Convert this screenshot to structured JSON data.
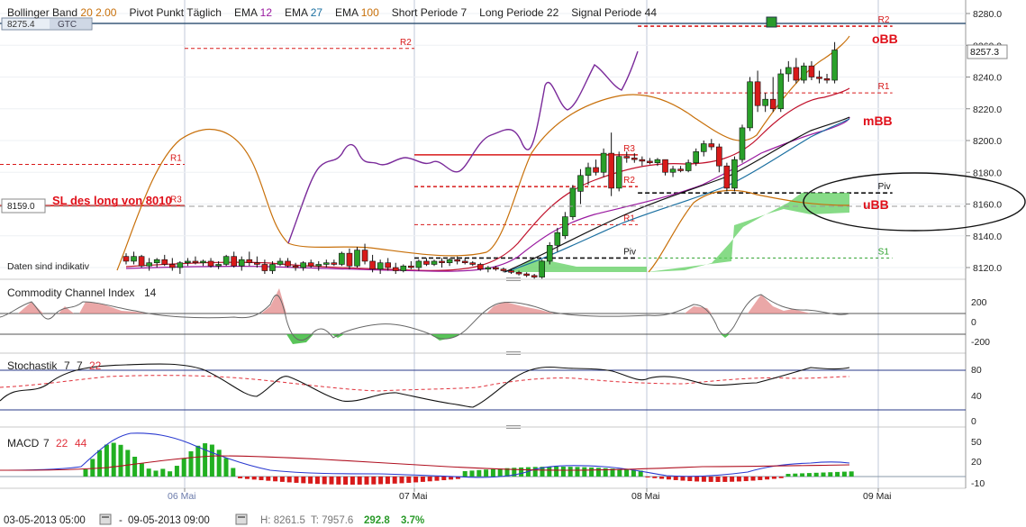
{
  "header": {
    "indicators": [
      {
        "name": "Bollinger Band",
        "params": [
          "20",
          "2.00"
        ],
        "color": "#c8700a"
      },
      {
        "name": "Pivot Punkt",
        "params": [
          "Täglich"
        ],
        "color": "#222222"
      },
      {
        "name": "EMA",
        "params": [
          "12"
        ],
        "color": "#9a1aa0"
      },
      {
        "name": "EMA",
        "params": [
          "27"
        ],
        "color": "#1a6fa0"
      },
      {
        "name": "EMA",
        "params": [
          "100"
        ],
        "color": "#c8700a"
      },
      {
        "name": "Short Periode",
        "params": [
          "7"
        ],
        "color": "#222222"
      },
      {
        "name": "Long Periode",
        "params": [
          "22"
        ],
        "color": "#222222"
      },
      {
        "name": "Signal Periode",
        "params": [
          "44"
        ],
        "color": "#222222"
      }
    ],
    "order_price": "8275.4",
    "order_type": "GTC"
  },
  "price_axis": {
    "ticks": [
      "8280.0",
      "8260.0",
      "8240.0",
      "8220.0",
      "8200.0",
      "8180.0",
      "8160.0",
      "8140.0",
      "8120.0"
    ],
    "current_price": "8257.3",
    "sl_price": "8159.0"
  },
  "annotations": {
    "sl_text": "SL des long von 8010",
    "obb": "oBB",
    "mbb": "mBB",
    "ubb": "uBB",
    "indicative": "Daten sind indikativ"
  },
  "pivots": {
    "r1": "R1",
    "r2": "R2",
    "r3": "R3",
    "piv": "Piv",
    "s1": "S1"
  },
  "cci": {
    "title": "Commodity Channel Index",
    "period": "14",
    "ticks": [
      "200",
      "0",
      "-200"
    ]
  },
  "stoch": {
    "title": "Stochastik",
    "k": "7",
    "d": "7",
    "slow": "22",
    "ticks": [
      "80",
      "40",
      "0"
    ]
  },
  "macd": {
    "title": "MACD",
    "fast": "7",
    "slow": "22",
    "signal": "44",
    "ticks": [
      "50",
      "20",
      "-10"
    ]
  },
  "time_axis": {
    "labels": [
      "06 Mai",
      "07 Mai",
      "08 Mai",
      "09 Mai"
    ]
  },
  "footer": {
    "start": "03-05-2013 05:00",
    "end": "09-05-2013 09:00",
    "high": "H: 8261.5",
    "low": "T: 7957.6",
    "change": "292.8",
    "pct": "3.7%"
  },
  "chart_data": {
    "type": "candlestick",
    "ylim": [
      8112,
      8288
    ],
    "candles": [
      {
        "o": 8127,
        "h": 8129,
        "l": 8122,
        "c": 8124
      },
      {
        "o": 8124,
        "h": 8130,
        "l": 8122,
        "c": 8127
      },
      {
        "o": 8127,
        "h": 8128,
        "l": 8120,
        "c": 8121
      },
      {
        "o": 8121,
        "h": 8126,
        "l": 8118,
        "c": 8123
      },
      {
        "o": 8123,
        "h": 8126,
        "l": 8120,
        "c": 8125
      },
      {
        "o": 8125,
        "h": 8128,
        "l": 8121,
        "c": 8122
      },
      {
        "o": 8122,
        "h": 8126,
        "l": 8118,
        "c": 8120
      },
      {
        "o": 8120,
        "h": 8124,
        "l": 8116,
        "c": 8123
      },
      {
        "o": 8123,
        "h": 8126,
        "l": 8121,
        "c": 8124
      },
      {
        "o": 8124,
        "h": 8127,
        "l": 8122,
        "c": 8123
      },
      {
        "o": 8123,
        "h": 8125,
        "l": 8121,
        "c": 8124
      },
      {
        "o": 8124,
        "h": 8126,
        "l": 8120,
        "c": 8121
      },
      {
        "o": 8121,
        "h": 8124,
        "l": 8119,
        "c": 8122
      },
      {
        "o": 8122,
        "h": 8128,
        "l": 8121,
        "c": 8127
      },
      {
        "o": 8127,
        "h": 8130,
        "l": 8120,
        "c": 8121
      },
      {
        "o": 8121,
        "h": 8127,
        "l": 8118,
        "c": 8125
      },
      {
        "o": 8125,
        "h": 8130,
        "l": 8121,
        "c": 8123
      },
      {
        "o": 8123,
        "h": 8127,
        "l": 8120,
        "c": 8122
      },
      {
        "o": 8122,
        "h": 8125,
        "l": 8116,
        "c": 8118
      },
      {
        "o": 8118,
        "h": 8124,
        "l": 8116,
        "c": 8122
      },
      {
        "o": 8122,
        "h": 8126,
        "l": 8121,
        "c": 8124
      },
      {
        "o": 8124,
        "h": 8126,
        "l": 8120,
        "c": 8121
      },
      {
        "o": 8121,
        "h": 8123,
        "l": 8118,
        "c": 8120
      },
      {
        "o": 8120,
        "h": 8124,
        "l": 8118,
        "c": 8123
      },
      {
        "o": 8123,
        "h": 8125,
        "l": 8120,
        "c": 8121
      },
      {
        "o": 8121,
        "h": 8124,
        "l": 8118,
        "c": 8122
      },
      {
        "o": 8122,
        "h": 8125,
        "l": 8120,
        "c": 8123
      },
      {
        "o": 8123,
        "h": 8125,
        "l": 8121,
        "c": 8122
      },
      {
        "o": 8122,
        "h": 8130,
        "l": 8121,
        "c": 8129
      },
      {
        "o": 8129,
        "h": 8132,
        "l": 8119,
        "c": 8121
      },
      {
        "o": 8121,
        "h": 8133,
        "l": 8120,
        "c": 8131
      },
      {
        "o": 8131,
        "h": 8135,
        "l": 8122,
        "c": 8124
      },
      {
        "o": 8124,
        "h": 8128,
        "l": 8117,
        "c": 8119
      },
      {
        "o": 8119,
        "h": 8125,
        "l": 8116,
        "c": 8123
      },
      {
        "o": 8123,
        "h": 8126,
        "l": 8118,
        "c": 8120
      },
      {
        "o": 8120,
        "h": 8123,
        "l": 8116,
        "c": 8118
      },
      {
        "o": 8118,
        "h": 8122,
        "l": 8117,
        "c": 8121
      },
      {
        "o": 8121,
        "h": 8124,
        "l": 8119,
        "c": 8120
      },
      {
        "o": 8120,
        "h": 8125,
        "l": 8118,
        "c": 8124
      },
      {
        "o": 8124,
        "h": 8126,
        "l": 8121,
        "c": 8122
      },
      {
        "o": 8122,
        "h": 8125,
        "l": 8121,
        "c": 8124
      },
      {
        "o": 8124,
        "h": 8126,
        "l": 8120,
        "c": 8123
      },
      {
        "o": 8123,
        "h": 8126,
        "l": 8121,
        "c": 8125
      },
      {
        "o": 8125,
        "h": 8127,
        "l": 8122,
        "c": 8124
      },
      {
        "o": 8124,
        "h": 8126,
        "l": 8122,
        "c": 8123
      },
      {
        "o": 8123,
        "h": 8124,
        "l": 8121,
        "c": 8122
      },
      {
        "o": 8122,
        "h": 8123,
        "l": 8118,
        "c": 8119
      },
      {
        "o": 8119,
        "h": 8121,
        "l": 8117,
        "c": 8120
      },
      {
        "o": 8120,
        "h": 8121,
        "l": 8118,
        "c": 8119
      },
      {
        "o": 8119,
        "h": 8120,
        "l": 8117,
        "c": 8118
      },
      {
        "o": 8118,
        "h": 8119,
        "l": 8116,
        "c": 8117
      },
      {
        "o": 8117,
        "h": 8118,
        "l": 8115,
        "c": 8116
      },
      {
        "o": 8116,
        "h": 8117,
        "l": 8114,
        "c": 8115
      },
      {
        "o": 8115,
        "h": 8116,
        "l": 8113,
        "c": 8114
      },
      {
        "o": 8114,
        "h": 8125,
        "l": 8113,
        "c": 8124
      },
      {
        "o": 8124,
        "h": 8136,
        "l": 8122,
        "c": 8134
      },
      {
        "o": 8134,
        "h": 8145,
        "l": 8130,
        "c": 8142
      },
      {
        "o": 8140,
        "h": 8155,
        "l": 8138,
        "c": 8152
      },
      {
        "o": 8152,
        "h": 8172,
        "l": 8150,
        "c": 8170
      },
      {
        "o": 8168,
        "h": 8182,
        "l": 8160,
        "c": 8178
      },
      {
        "o": 8178,
        "h": 8186,
        "l": 8172,
        "c": 8183
      },
      {
        "o": 8183,
        "h": 8188,
        "l": 8178,
        "c": 8180
      },
      {
        "o": 8180,
        "h": 8195,
        "l": 8177,
        "c": 8192
      },
      {
        "o": 8192,
        "h": 8205,
        "l": 8165,
        "c": 8170
      },
      {
        "o": 8170,
        "h": 8193,
        "l": 8168,
        "c": 8190
      },
      {
        "o": 8190,
        "h": 8193,
        "l": 8186,
        "c": 8189
      },
      {
        "o": 8189,
        "h": 8192,
        "l": 8186,
        "c": 8188
      },
      {
        "o": 8188,
        "h": 8190,
        "l": 8184,
        "c": 8187
      },
      {
        "o": 8187,
        "h": 8189,
        "l": 8185,
        "c": 8186
      },
      {
        "o": 8186,
        "h": 8189,
        "l": 8184,
        "c": 8188
      },
      {
        "o": 8188,
        "h": 8188,
        "l": 8178,
        "c": 8180
      },
      {
        "o": 8180,
        "h": 8184,
        "l": 8177,
        "c": 8182
      },
      {
        "o": 8182,
        "h": 8184,
        "l": 8180,
        "c": 8181
      },
      {
        "o": 8181,
        "h": 8188,
        "l": 8180,
        "c": 8186
      },
      {
        "o": 8186,
        "h": 8195,
        "l": 8184,
        "c": 8193
      },
      {
        "o": 8193,
        "h": 8200,
        "l": 8190,
        "c": 8198
      },
      {
        "o": 8198,
        "h": 8201,
        "l": 8194,
        "c": 8196
      },
      {
        "o": 8196,
        "h": 8198,
        "l": 8180,
        "c": 8184
      },
      {
        "o": 8184,
        "h": 8186,
        "l": 8168,
        "c": 8170
      },
      {
        "o": 8170,
        "h": 8190,
        "l": 8168,
        "c": 8188
      },
      {
        "o": 8188,
        "h": 8210,
        "l": 8186,
        "c": 8208
      },
      {
        "o": 8208,
        "h": 8240,
        "l": 8206,
        "c": 8237
      },
      {
        "o": 8237,
        "h": 8244,
        "l": 8218,
        "c": 8222
      },
      {
        "o": 8222,
        "h": 8230,
        "l": 8218,
        "c": 8226
      },
      {
        "o": 8226,
        "h": 8240,
        "l": 8218,
        "c": 8220
      },
      {
        "o": 8220,
        "h": 8245,
        "l": 8218,
        "c": 8242
      },
      {
        "o": 8242,
        "h": 8250,
        "l": 8237,
        "c": 8246
      },
      {
        "o": 8246,
        "h": 8252,
        "l": 8236,
        "c": 8238
      },
      {
        "o": 8238,
        "h": 8249,
        "l": 8236,
        "c": 8247
      },
      {
        "o": 8247,
        "h": 8250,
        "l": 8238,
        "c": 8240
      },
      {
        "o": 8240,
        "h": 8244,
        "l": 8236,
        "c": 8239
      },
      {
        "o": 8239,
        "h": 8242,
        "l": 8236,
        "c": 8238
      },
      {
        "o": 8238,
        "h": 8262,
        "l": 8236,
        "c": 8257
      }
    ],
    "pivot_levels": [
      {
        "label": "R3",
        "value": 8159,
        "x0": 0.0,
        "x1": 0.29
      },
      {
        "label": "R2",
        "value": 8258,
        "x0": 0.29,
        "x1": 0.66
      },
      {
        "label": "R1",
        "value": 8185,
        "x0": 0.0,
        "x1": 0.29
      },
      {
        "label": "R3",
        "value": 8191,
        "x0": 0.66,
        "x1": 1.02
      },
      {
        "label": "R2",
        "value": 8171,
        "x0": 0.66,
        "x1": 1.02
      },
      {
        "label": "R1",
        "value": 8147,
        "x0": 0.66,
        "x1": 1.02
      },
      {
        "label": "Piv",
        "value": 8126,
        "x0": 0.66,
        "x1": 1.02
      },
      {
        "label": "R2",
        "value": 8272,
        "x0": 1.02,
        "x1": 1.43
      },
      {
        "label": "R1",
        "value": 8230,
        "x0": 1.02,
        "x1": 1.43
      },
      {
        "label": "Piv",
        "value": 8167,
        "x0": 1.02,
        "x1": 1.43
      },
      {
        "label": "S1",
        "value": 8126,
        "x0": 1.02,
        "x1": 1.43
      }
    ]
  }
}
